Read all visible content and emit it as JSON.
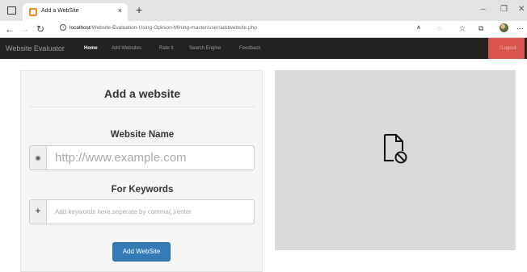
{
  "browser": {
    "tab_title": "Add a WebSite",
    "tab_close": "×",
    "new_tab": "+",
    "url_host": "localhost",
    "url_path": "/Website-Evaluation-Using-Opinion-Mining-master/user/addwebsite.php",
    "icons": {
      "window": "window-icon",
      "favicon": "site-favicon-icon",
      "back": "back-arrow-icon",
      "forward": "forward-arrow-icon",
      "refresh": "refresh-icon",
      "info": "site-info-icon",
      "read_aloud": "read-aloud-icon",
      "tracking": "tracking-prevention-icon",
      "favorites": "favorites-star-icon",
      "collections": "collections-icon",
      "profile": "profile-avatar",
      "more": "more-menu-icon",
      "minimize": "minimize-icon",
      "maximize": "restore-icon",
      "close": "close-window-icon"
    }
  },
  "navbar": {
    "brand": "Website Evaluator",
    "links": [
      {
        "label": "Home",
        "active": true
      },
      {
        "label": "Add Websites",
        "active": false
      },
      {
        "label": "Rate It",
        "active": false
      },
      {
        "label": "Search Engine",
        "active": false
      },
      {
        "label": "Feedback",
        "active": false
      }
    ],
    "logout": "Logout",
    "logout_color": "#d9534f"
  },
  "form": {
    "title": "Add a website",
    "website_name_label": "Website Name",
    "website_addon_icon": "globe-icon",
    "website_placeholder": "http://www.example.com",
    "keywords_label": "For Keywords",
    "keywords_addon_icon": "plus-icon",
    "keywords_placeholder": "Add keywords here.seperate by comma(,)/enter",
    "submit_label": "Add WebSite",
    "submit_color": "#337ab7"
  },
  "preview": {
    "icon": "broken-image-icon"
  }
}
